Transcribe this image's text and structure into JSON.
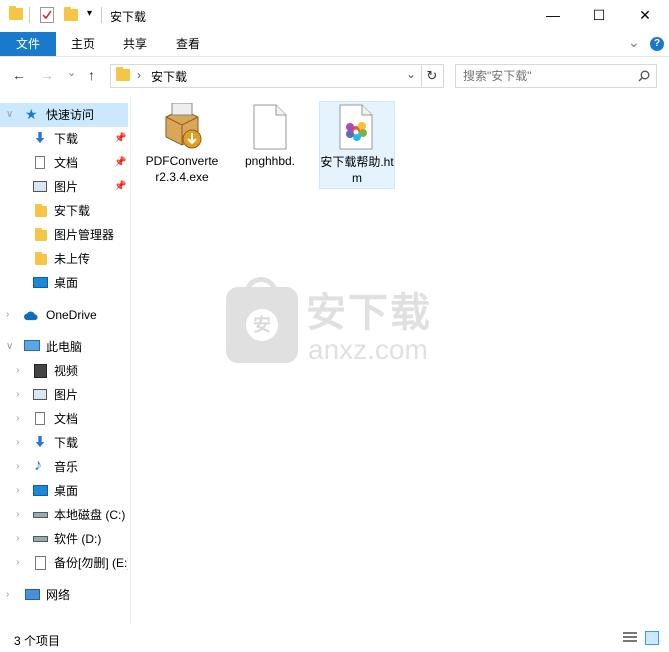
{
  "window": {
    "title": "安下载",
    "minimize": "—",
    "maximize": "☐",
    "close": "✕"
  },
  "ribbon": {
    "tabs": [
      {
        "label": "文件"
      },
      {
        "label": "主页"
      },
      {
        "label": "共享"
      },
      {
        "label": "查看"
      }
    ],
    "expand": "⌄",
    "help": "?"
  },
  "nav": {
    "back": "←",
    "forward": "→",
    "recent": "⌄",
    "up": "↑",
    "breadcrumb_sep": "›",
    "breadcrumb": "安下载",
    "address_dropdown": "⌄",
    "refresh": "↻"
  },
  "search": {
    "placeholder": "搜索\"安下载\""
  },
  "sidebar": {
    "quick_access": "快速访问",
    "quick_items": [
      {
        "label": "下载",
        "pinned": true
      },
      {
        "label": "文档",
        "pinned": true
      },
      {
        "label": "图片",
        "pinned": true
      },
      {
        "label": "安下载"
      },
      {
        "label": "图片管理器"
      },
      {
        "label": "未上传"
      },
      {
        "label": "桌面"
      }
    ],
    "onedrive": "OneDrive",
    "this_pc": "此电脑",
    "pc_items": [
      {
        "label": "视频"
      },
      {
        "label": "图片"
      },
      {
        "label": "文档"
      },
      {
        "label": "下载"
      },
      {
        "label": "音乐"
      },
      {
        "label": "桌面"
      },
      {
        "label": "本地磁盘 (C:)"
      },
      {
        "label": "软件 (D:)"
      },
      {
        "label": "备份[勿删] (E:)"
      }
    ],
    "network": "网络"
  },
  "files": [
    {
      "name": "PDFConverter2.3.4.exe",
      "icon": "installer-icon"
    },
    {
      "name": "pnghhbd.",
      "icon": "blank-file-icon"
    },
    {
      "name": "安下载帮助.htm",
      "icon": "htm-file-icon"
    }
  ],
  "watermark": {
    "cn": "安下载",
    "en": "anxz.com",
    "badge": "安"
  },
  "status": {
    "count": "3 个项目"
  },
  "colors": {
    "accent": "#1979ca",
    "folder": "#f5c643",
    "selection": "#cce8ff"
  }
}
